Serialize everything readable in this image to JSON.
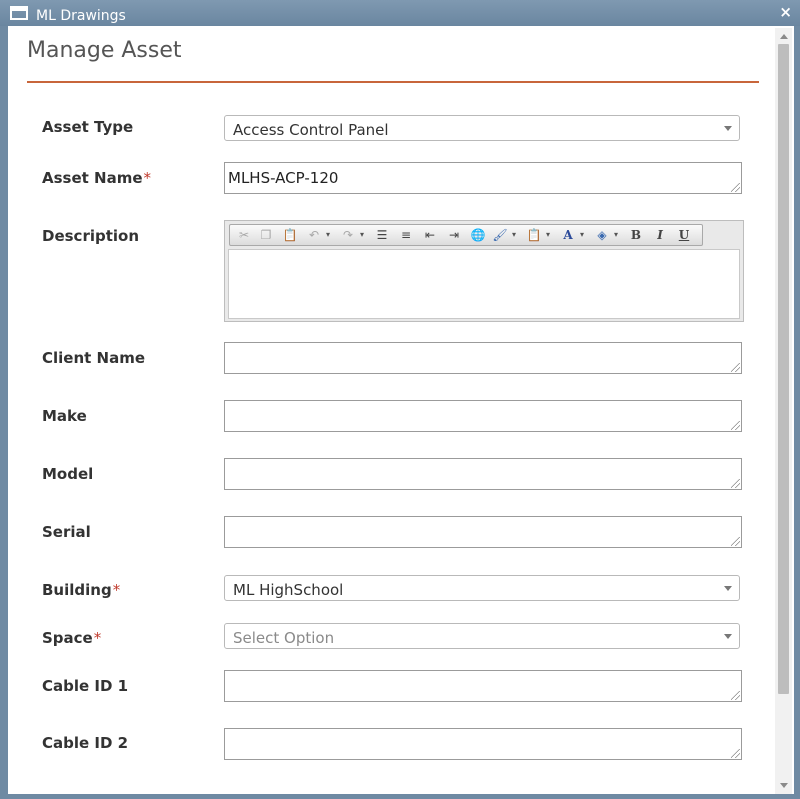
{
  "window": {
    "title": "ML Drawings",
    "close_symbol": "×"
  },
  "page": {
    "heading": "Manage Asset"
  },
  "form": {
    "asset_type": {
      "label": "Asset Type",
      "value": "Access Control Panel"
    },
    "asset_name": {
      "label": "Asset Name",
      "required_mark": "*",
      "value": "MLHS-ACP-120"
    },
    "description": {
      "label": "Description",
      "value": ""
    },
    "client_name": {
      "label": "Client Name",
      "value": ""
    },
    "make": {
      "label": "Make",
      "value": ""
    },
    "model": {
      "label": "Model",
      "value": ""
    },
    "serial": {
      "label": "Serial",
      "value": ""
    },
    "building": {
      "label": "Building",
      "required_mark": "*",
      "value": "ML HighSchool"
    },
    "space": {
      "label": "Space",
      "required_mark": "*",
      "placeholder": "Select Option"
    },
    "cable_id_1": {
      "label": "Cable ID 1",
      "value": ""
    },
    "cable_id_2": {
      "label": "Cable ID 2",
      "value": ""
    }
  },
  "editor_toolbar": {
    "buttons": [
      "cut-icon",
      "copy-icon",
      "paste-icon",
      "undo-icon",
      "redo-icon",
      "bullet-list-icon",
      "numbered-list-icon",
      "outdent-icon",
      "indent-icon",
      "link-icon",
      "format-brush-icon",
      "paste-special-icon",
      "font-color-icon",
      "highlight-icon",
      "bold-icon",
      "italic-icon",
      "underline-icon"
    ],
    "bold": "B",
    "italic": "I",
    "underline": "U",
    "font_color": "A"
  }
}
